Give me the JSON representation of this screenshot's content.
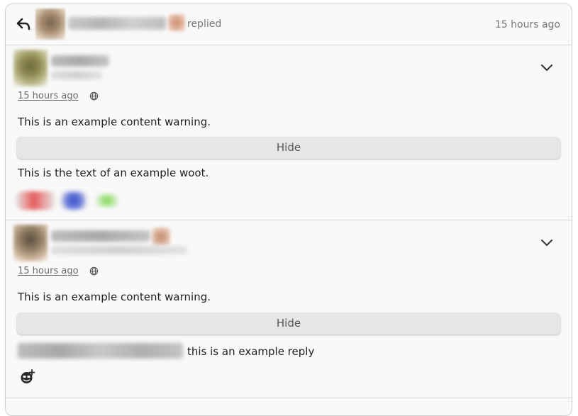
{
  "header": {
    "action": "replied",
    "time": "15 hours ago"
  },
  "posts": [
    {
      "timestamp": "15 hours ago",
      "content_warning": "This is an example content warning.",
      "hide_label": "Hide",
      "text": "This is the text of an example woot."
    },
    {
      "timestamp": "15 hours ago",
      "content_warning": "This is an example content warning.",
      "hide_label": "Hide",
      "text": "this is an example reply"
    }
  ],
  "icons": {
    "reply": "reply-arrow-icon",
    "expand": "chevron-down-icon",
    "visibility": "globe-icon",
    "add_reaction": "add-reaction-icon"
  }
}
